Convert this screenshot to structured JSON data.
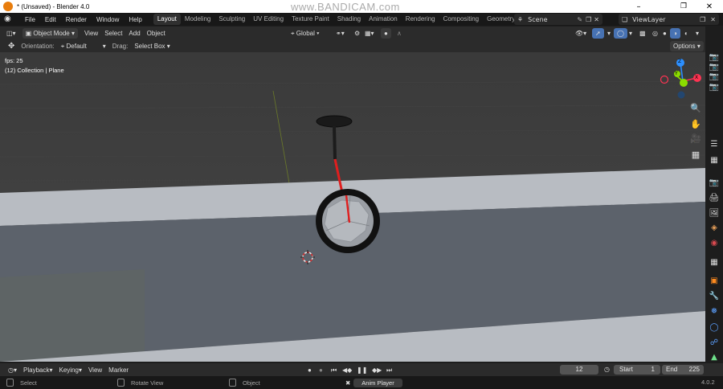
{
  "window": {
    "title": "* (Unsaved) - Blender 4.0",
    "watermark": "www.BANDICAM.com",
    "minimize": "–",
    "maximize": "❐",
    "close": "✕"
  },
  "menu": [
    "File",
    "Edit",
    "Render",
    "Window",
    "Help"
  ],
  "workspaces": [
    "Layout",
    "Modeling",
    "Sculpting",
    "UV Editing",
    "Texture Paint",
    "Shading",
    "Animation",
    "Rendering",
    "Compositing",
    "Geometry"
  ],
  "active_workspace": "Layout",
  "scene": {
    "label": "Scene"
  },
  "view_layer": {
    "label": "ViewLayer"
  },
  "viewport_header": {
    "mode": "Object Mode",
    "menus": [
      "View",
      "Select",
      "Add",
      "Object"
    ],
    "transform_orientation": "Global",
    "options": "Options"
  },
  "tool_settings": {
    "orientation_label": "Orientation:",
    "orientation_value": "Default",
    "drag_label": "Drag:",
    "drag_value": "Select Box"
  },
  "viewport": {
    "fps": "fps: 25",
    "collection": "(12) Collection | Plane",
    "gizmo_axes": {
      "z": "Z",
      "y": "Y",
      "x": "X"
    }
  },
  "timeline": {
    "menus": [
      "Playback",
      "Keying",
      "View",
      "Marker"
    ],
    "current_frame": "12",
    "start_label": "Start",
    "start_value": "1",
    "end_label": "End",
    "end_value": "225"
  },
  "statusbar": {
    "select": "Select",
    "rotate": "Rotate View",
    "object": "Object",
    "anim_player": "Anim Player",
    "version": "4.0.2"
  },
  "colors": {
    "accent": "#4772b3",
    "x_axis": "#ff3352",
    "y_axis": "#8bdc00",
    "z_axis": "#2c8fff",
    "unicycle_pole": "#e01e1e"
  }
}
